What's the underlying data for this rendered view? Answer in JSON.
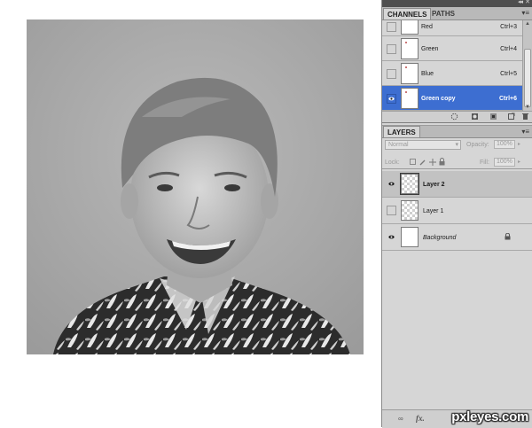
{
  "photo": {
    "description_icon": "grayscale-portrait"
  },
  "panel": {
    "collapse_glyph": "◂◂",
    "close_glyph": "✕",
    "menu_glyph": "▾≡"
  },
  "channels": {
    "tabs": [
      {
        "label": "CHANNELS",
        "active": true
      },
      {
        "label": "PATHS",
        "active": false
      }
    ],
    "rows": [
      {
        "name": "Red",
        "shortcut": "Ctrl+3",
        "visible": false,
        "selected": false
      },
      {
        "name": "Green",
        "shortcut": "Ctrl+4",
        "visible": false,
        "selected": false
      },
      {
        "name": "Blue",
        "shortcut": "Ctrl+5",
        "visible": false,
        "selected": false
      },
      {
        "name": "Green copy",
        "shortcut": "Ctrl+6",
        "visible": true,
        "selected": true
      }
    ],
    "bottom_icons": [
      "load-selection-icon",
      "save-selection-icon",
      "mask-icon",
      "new-channel-icon",
      "trash-icon"
    ]
  },
  "layers": {
    "tab_label": "LAYERS",
    "blend_mode": "Normal",
    "opacity_label": "Opacity:",
    "opacity_value": "100%",
    "lock_label": "Lock:",
    "fill_label": "Fill:",
    "fill_value": "100%",
    "rows": [
      {
        "name": "Layer 2",
        "visible": true,
        "selected": true,
        "style": "bold",
        "transparent": true
      },
      {
        "name": "Layer 1",
        "visible": false,
        "selected": false,
        "style": "normal",
        "transparent": true
      },
      {
        "name": "Background",
        "visible": true,
        "selected": false,
        "style": "italic",
        "transparent": false,
        "locked": true
      }
    ],
    "bottom": {
      "link": "∞",
      "fx": "fx."
    }
  },
  "watermark": "pxleyes.com",
  "colors": {
    "selection_blue": "#3d6ed1",
    "panel_bg": "#d6d6d6",
    "titlebar": "#4f4f4f"
  }
}
